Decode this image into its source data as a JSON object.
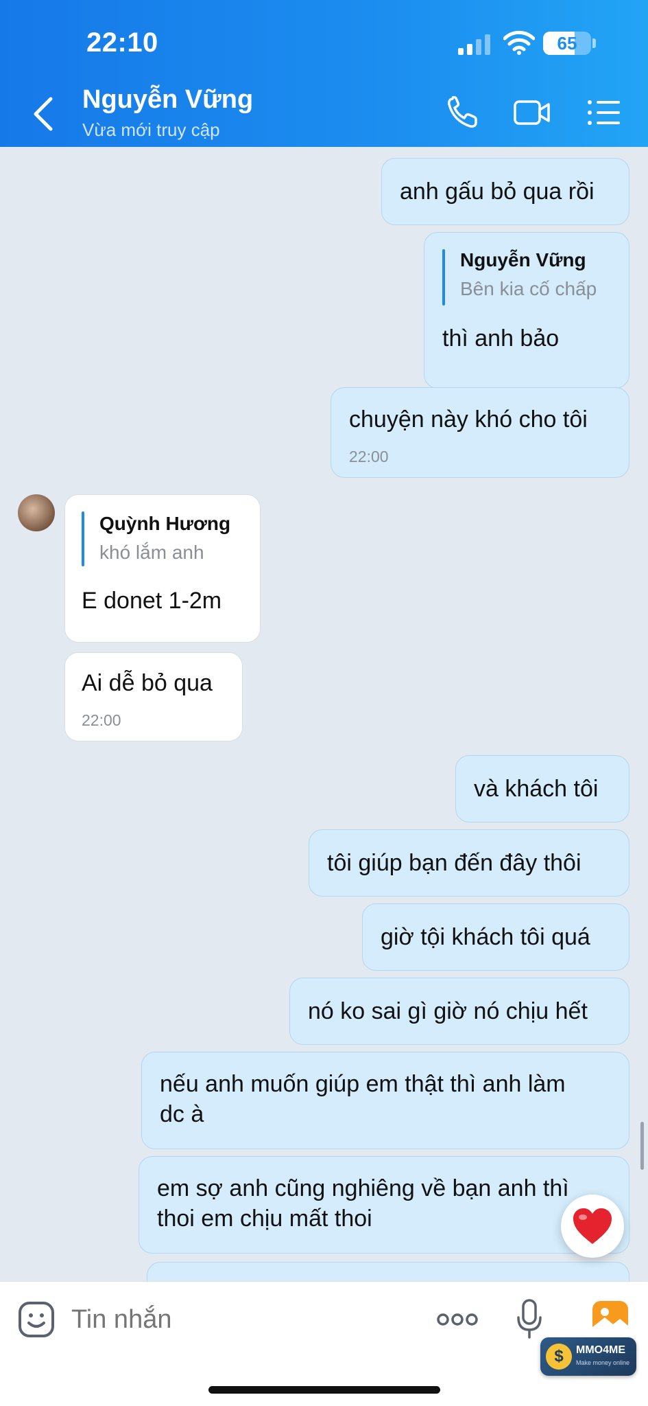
{
  "status_bar": {
    "time": "22:10",
    "battery": "65",
    "battery_level": 0.65
  },
  "header": {
    "contact_name": "Nguyễn Vững",
    "contact_status": "Vừa mới truy cập",
    "icons": [
      "back-icon",
      "phone-icon",
      "video-icon",
      "menu-icon"
    ]
  },
  "messages": [
    {
      "from": "me",
      "text": "anh gấu bỏ qua rồi"
    },
    {
      "from": "me",
      "quote": {
        "name": "Nguyễn Vững",
        "text": "Bên kia cố chấp"
      },
      "text": "thì anh bảo"
    },
    {
      "from": "me",
      "text": "chuyện này khó cho tôi",
      "time": "22:00"
    },
    {
      "from": "them",
      "quote": {
        "name": "Quỳnh Hương",
        "text": "khó lắm anh"
      },
      "text": "E donet 1-2m"
    },
    {
      "from": "them",
      "text": "Ai dễ bỏ qua",
      "time": "22:00"
    },
    {
      "from": "me",
      "text": "và khách tôi"
    },
    {
      "from": "me",
      "text": "tôi giúp bạn đến đây thôi"
    },
    {
      "from": "me",
      "text": "giờ tội khách tôi quá"
    },
    {
      "from": "me",
      "text": "nó ko sai gì giờ nó chịu hết"
    },
    {
      "from": "me",
      "lines": [
        "nếu anh muốn giúp em thật thì anh làm",
        "dc à"
      ]
    },
    {
      "from": "me",
      "lines": [
        "em sợ anh cũng nghiêng về bạn anh thì",
        "thoi em chịu mất thoi"
      ]
    }
  ],
  "composer": {
    "placeholder": "Tin nhắn"
  },
  "watermark": {
    "title": "MMO4ME",
    "subtitle": "Make money online",
    "coin": "$"
  },
  "colors": {
    "header": "#1c8ef0",
    "my_bubble": "#d4ecfb",
    "their_bubble": "#ffffff",
    "background": "#e2e9f1"
  }
}
